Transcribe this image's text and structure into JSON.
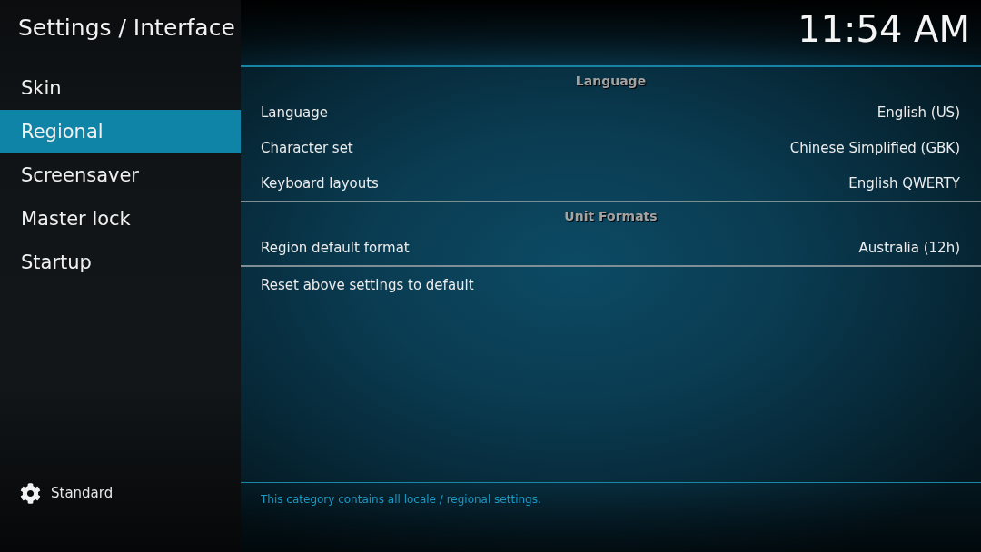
{
  "header": {
    "title": "Settings / Interface",
    "clock": "11:54 AM"
  },
  "sidebar": {
    "items": [
      {
        "label": "Skin",
        "selected": false
      },
      {
        "label": "Regional",
        "selected": true
      },
      {
        "label": "Screensaver",
        "selected": false
      },
      {
        "label": "Master lock",
        "selected": false
      },
      {
        "label": "Startup",
        "selected": false
      }
    ],
    "settings_level": {
      "label": "Standard"
    }
  },
  "settings": {
    "sections": [
      {
        "title": "Language",
        "rows": [
          {
            "label": "Language",
            "value": "English (US)"
          },
          {
            "label": "Character set",
            "value": "Chinese Simplified (GBK)"
          },
          {
            "label": "Keyboard layouts",
            "value": "English QWERTY"
          }
        ]
      },
      {
        "title": "Unit Formats",
        "rows": [
          {
            "label": "Region default format",
            "value": "Australia (12h)"
          }
        ]
      }
    ],
    "actions": [
      {
        "label": "Reset above settings to default"
      }
    ]
  },
  "description": "This category contains all locale / regional settings."
}
